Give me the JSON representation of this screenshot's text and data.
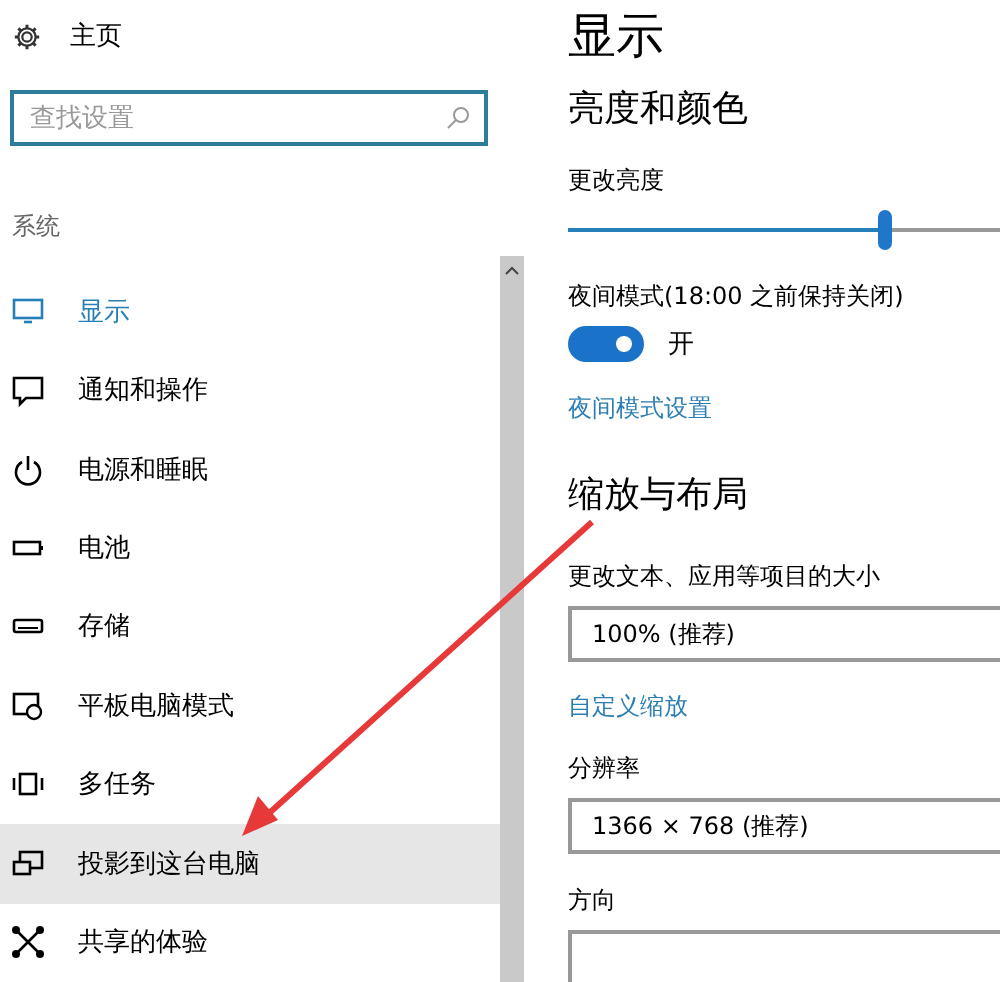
{
  "sidebar": {
    "home": {
      "label": "主页"
    },
    "search": {
      "placeholder": "查找设置"
    },
    "section": "系统",
    "items": [
      {
        "label": "显示",
        "selected": true,
        "hovered": false
      },
      {
        "label": "通知和操作",
        "selected": false,
        "hovered": false
      },
      {
        "label": "电源和睡眠",
        "selected": false,
        "hovered": false
      },
      {
        "label": "电池",
        "selected": false,
        "hovered": false
      },
      {
        "label": "存储",
        "selected": false,
        "hovered": false
      },
      {
        "label": "平板电脑模式",
        "selected": false,
        "hovered": false
      },
      {
        "label": "多任务",
        "selected": false,
        "hovered": false
      },
      {
        "label": "投影到这台电脑",
        "selected": false,
        "hovered": true
      },
      {
        "label": "共享的体验",
        "selected": false,
        "hovered": false
      }
    ]
  },
  "main": {
    "title": "显示",
    "sections": [
      {
        "heading": "亮度和颜色",
        "controls": [
          {
            "kind": "slider",
            "label": "更改亮度",
            "level": 0.66
          },
          {
            "kind": "toggle",
            "label": "夜间模式(18:00 之前保持关闭)",
            "on": true,
            "state_text": "开"
          },
          {
            "kind": "link",
            "label": "夜间模式设置"
          }
        ]
      },
      {
        "heading": "缩放与布局",
        "controls": [
          {
            "kind": "dropdown",
            "label": "更改文本、应用等项目的大小",
            "value": "100% (推荐)"
          },
          {
            "kind": "link",
            "label": "自定义缩放"
          },
          {
            "kind": "dropdown",
            "label": "分辨率",
            "value": "1366 × 768 (推荐)"
          },
          {
            "kind": "dropdown",
            "label": "方向"
          }
        ]
      }
    ]
  }
}
